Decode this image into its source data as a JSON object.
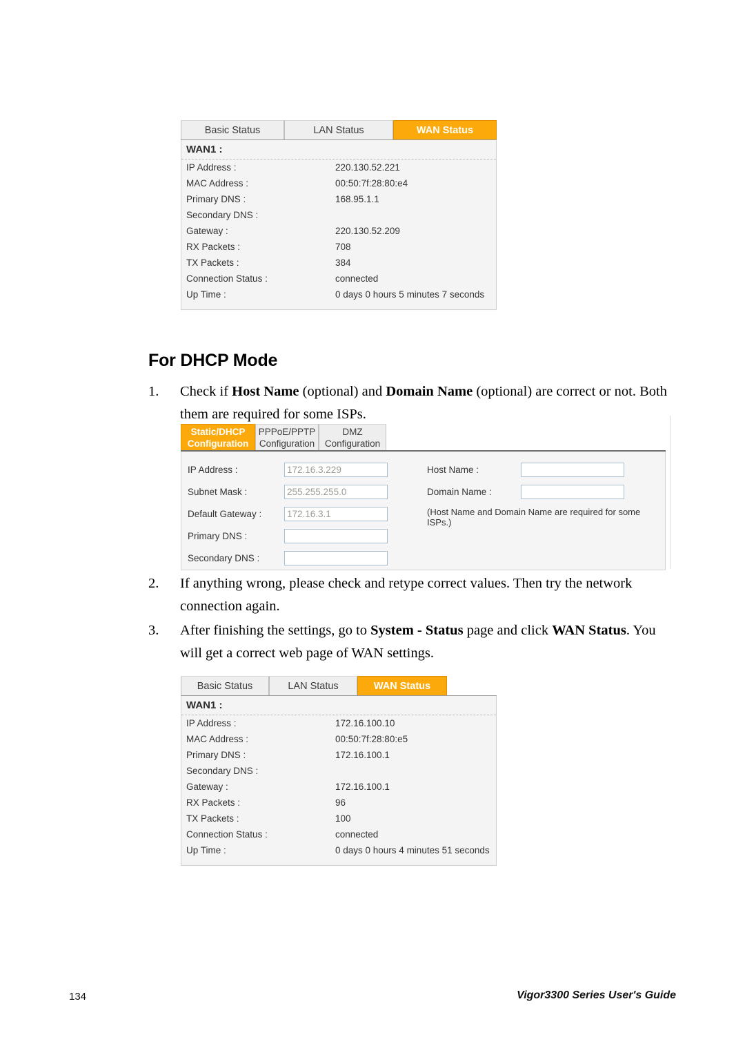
{
  "page": {
    "heading": "For DHCP Mode",
    "footer_page_number": "134",
    "footer_title": "Vigor3300 Series User's Guide",
    "accent_color": "#fca90b"
  },
  "steps": [
    {
      "number": "1.",
      "parts": [
        {
          "text": "Check if ",
          "bold": false
        },
        {
          "text": "Host Name",
          "bold": true
        },
        {
          "text": " (optional) and ",
          "bold": false
        },
        {
          "text": "Domain Name",
          "bold": true
        },
        {
          "text": " (optional) are correct or not. Both them are required for some ISPs.",
          "bold": false
        }
      ]
    },
    {
      "number": "2.",
      "parts": [
        {
          "text": "If anything wrong, please check and retype correct values. Then try the network connection again.",
          "bold": false
        }
      ]
    },
    {
      "number": "3.",
      "parts": [
        {
          "text": "After finishing the settings, go to ",
          "bold": false
        },
        {
          "text": "System - Status",
          "bold": true
        },
        {
          "text": " page and click ",
          "bold": false
        },
        {
          "text": "WAN Status",
          "bold": true
        },
        {
          "text": ". You will get a correct web page of WAN settings.",
          "bold": false
        }
      ]
    }
  ],
  "status_panel_top": {
    "tabs": [
      {
        "label": "Basic Status",
        "active": false
      },
      {
        "label": "LAN Status",
        "active": false
      },
      {
        "label": "WAN Status",
        "active": true
      }
    ],
    "section_title": "WAN1 :",
    "rows": [
      {
        "key": "IP Address :",
        "value": "220.130.52.221"
      },
      {
        "key": "MAC Address :",
        "value": "00:50:7f:28:80:e4"
      },
      {
        "key": "Primary DNS :",
        "value": "168.95.1.1"
      },
      {
        "key": "Secondary DNS :",
        "value": ""
      },
      {
        "key": "Gateway :",
        "value": "220.130.52.209"
      },
      {
        "key": "RX Packets :",
        "value": "708"
      },
      {
        "key": "TX Packets :",
        "value": "384"
      },
      {
        "key": "Connection Status :",
        "value": "connected"
      },
      {
        "key": "Up Time :",
        "value": "0 days 0 hours 5 minutes 7 seconds"
      }
    ]
  },
  "status_panel_bottom": {
    "tabs": [
      {
        "label": "Basic Status",
        "active": false
      },
      {
        "label": "LAN Status",
        "active": false
      },
      {
        "label": "WAN Status",
        "active": true
      }
    ],
    "section_title": "WAN1 :",
    "rows": [
      {
        "key": "IP Address :",
        "value": "172.16.100.10"
      },
      {
        "key": "MAC Address :",
        "value": "00:50:7f:28:80:e5"
      },
      {
        "key": "Primary DNS :",
        "value": "172.16.100.1"
      },
      {
        "key": "Secondary DNS :",
        "value": ""
      },
      {
        "key": "Gateway :",
        "value": "172.16.100.1"
      },
      {
        "key": "RX Packets :",
        "value": "96"
      },
      {
        "key": "TX Packets :",
        "value": "100"
      },
      {
        "key": "Connection Status :",
        "value": "connected"
      },
      {
        "key": "Up Time :",
        "value": "0 days 0 hours 4 minutes 51 seconds"
      }
    ]
  },
  "config_panel": {
    "tabs": [
      {
        "line1": "Static/DHCP",
        "line2": "Configuration",
        "active": true
      },
      {
        "line1": "PPPoE/PPTP",
        "line2": "Configuration",
        "active": false
      },
      {
        "line1": "DMZ",
        "line2": "Configuration",
        "active": false
      }
    ],
    "left_fields": [
      {
        "label": "IP Address :",
        "value": "172.16.3.229"
      },
      {
        "label": "Subnet Mask :",
        "value": "255.255.255.0"
      },
      {
        "label": "Default Gateway :",
        "value": "172.16.3.1"
      },
      {
        "label": "Primary DNS :",
        "value": ""
      },
      {
        "label": "Secondary DNS :",
        "value": ""
      }
    ],
    "right_fields": [
      {
        "label": "Host Name :",
        "value": ""
      },
      {
        "label": "Domain Name :",
        "value": ""
      }
    ],
    "note": "(Host Name and Domain Name are required for some ISPs.)"
  }
}
